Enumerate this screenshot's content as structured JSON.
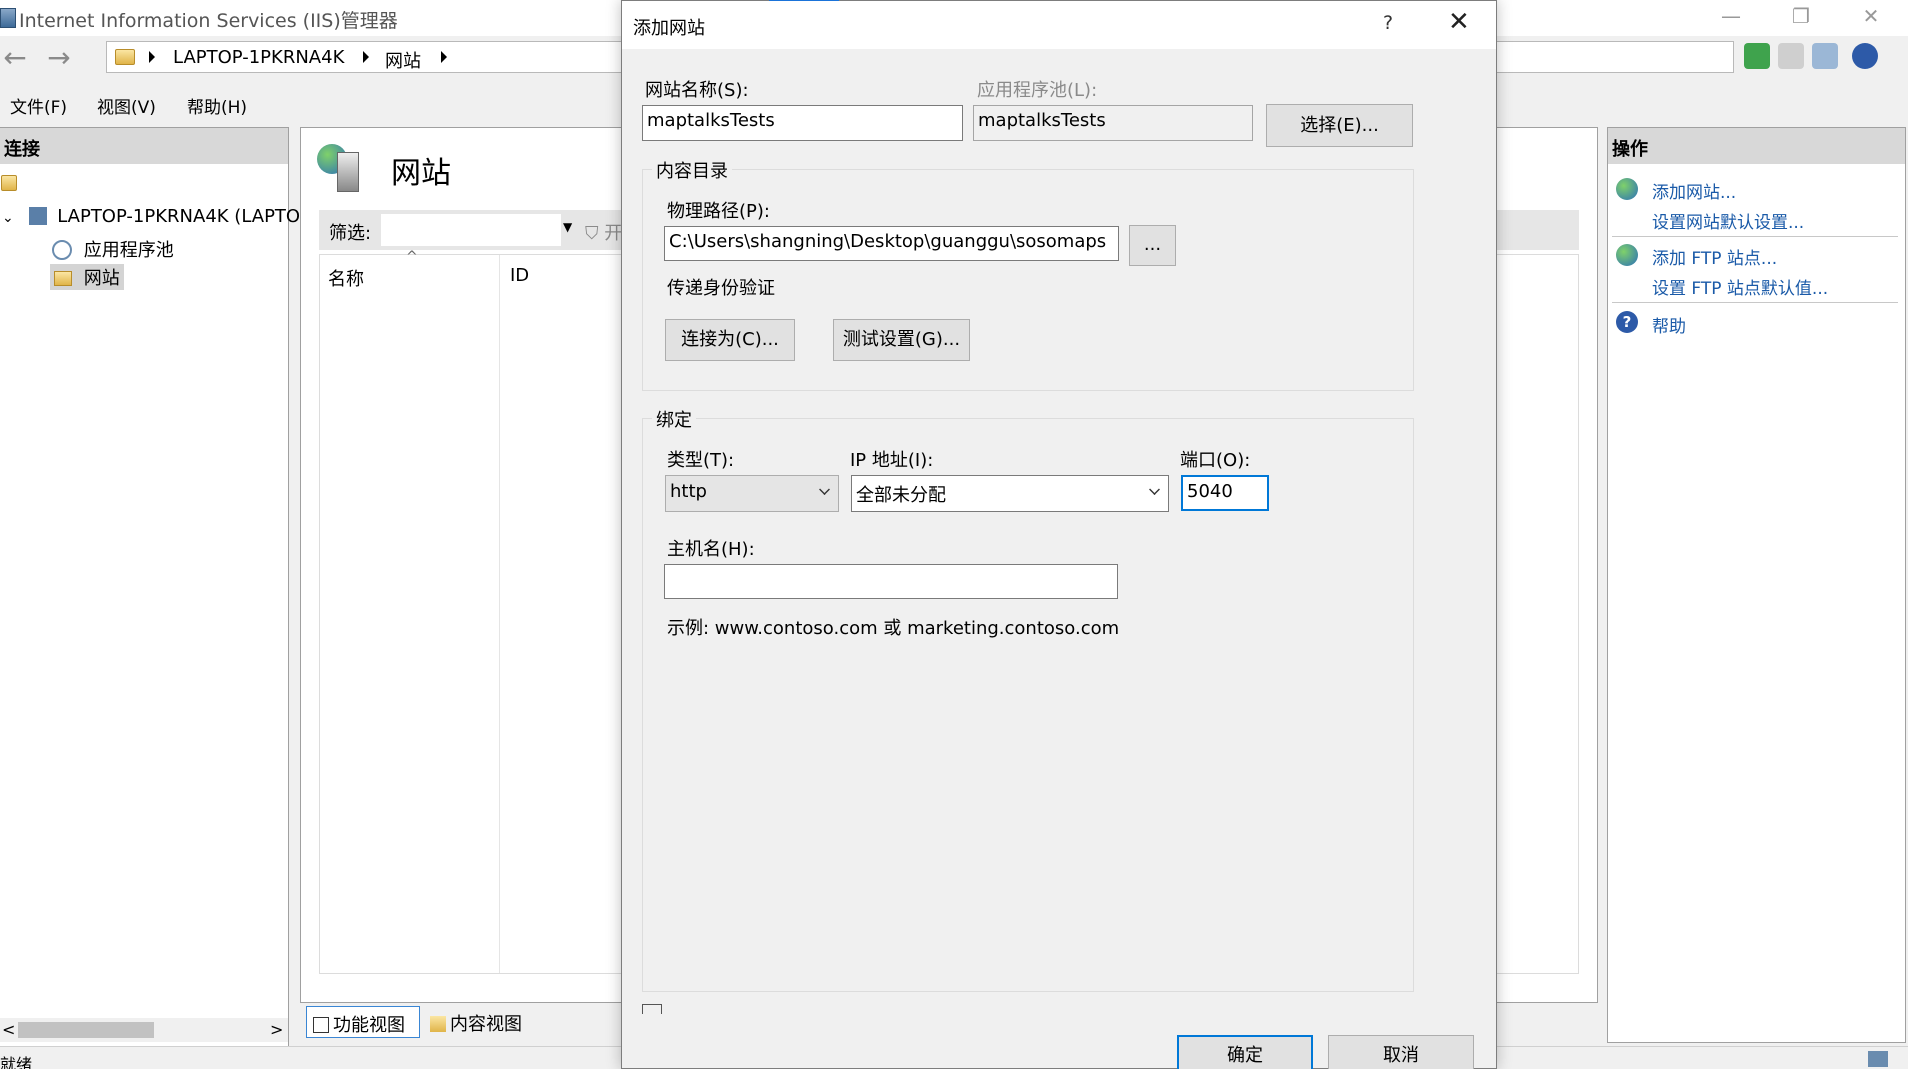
{
  "window": {
    "title": "Internet Information Services (IIS)管理器",
    "minimize": "—",
    "restore": "❐",
    "close": "✕"
  },
  "address": {
    "segments": [
      "LAPTOP-1PKRNA4K",
      "网站"
    ]
  },
  "menu": {
    "items": [
      "文件(F)",
      "视图(V)",
      "帮助(H)"
    ]
  },
  "connections": {
    "header": "连接",
    "server": "LAPTOP-1PKRNA4K (LAPTO",
    "app_pools": "应用程序池",
    "sites": "网站"
  },
  "center": {
    "title": "网站",
    "filter_label": "筛选:",
    "go_label": "开始",
    "col_name": "名称",
    "col_id": "ID",
    "tab_features": "功能视图",
    "tab_content": "内容视图"
  },
  "actions": {
    "header": "操作",
    "add_site": "添加网站...",
    "site_defaults": "设置网站默认设置...",
    "add_ftp": "添加 FTP 站点...",
    "ftp_defaults": "设置 FTP 站点默认值...",
    "help": "帮助"
  },
  "status": {
    "text": "就绪"
  },
  "dialog": {
    "title": "添加网站",
    "help": "?",
    "close": "✕",
    "site_name_label": "网站名称(S):",
    "site_name_value": "maptalksTests",
    "app_pool_label": "应用程序池(L):",
    "app_pool_value": "maptalksTests",
    "select_button": "选择(E)...",
    "content_dir_title": "内容目录",
    "physical_path_label": "物理路径(P):",
    "physical_path_value": "C:\\Users\\shangning\\Desktop\\guanggu\\sosomaps",
    "browse_button": "...",
    "pass_through_label": "传递身份验证",
    "connect_as_button": "连接为(C)...",
    "test_settings_button": "测试设置(G)...",
    "binding_title": "绑定",
    "type_label": "类型(T):",
    "type_value": "http",
    "ip_label": "IP 地址(I):",
    "ip_value": "全部未分配",
    "port_label": "端口(O):",
    "port_value": "5040",
    "host_label": "主机名(H):",
    "host_value": "",
    "example_text": "示例: www.contoso.com 或 marketing.contoso.com",
    "ok_button": "确定",
    "cancel_button": "取消"
  }
}
